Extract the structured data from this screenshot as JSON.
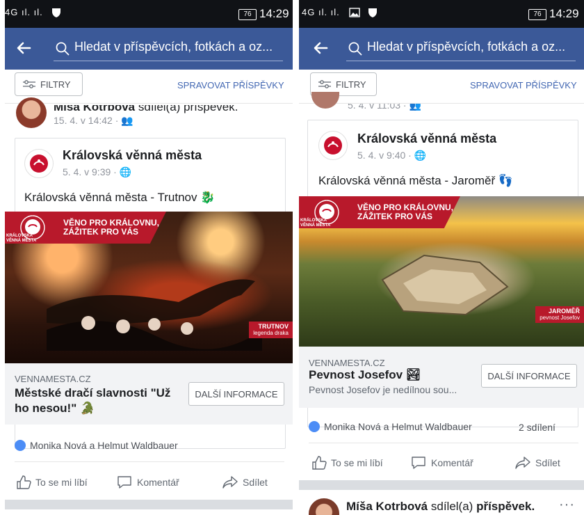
{
  "left": {
    "status": {
      "network": "4G",
      "battery": "76",
      "time": "14:29"
    },
    "search": {
      "placeholder": "Hledat v příspěvcích, fotkách a oz..."
    },
    "filter_label": "FILTRY",
    "manage_label": "SPRAVOVAT PŘÍSPĚVKY",
    "sharer": {
      "name": "Míša Kotrbová",
      "action": "sdílel(a) příspěvek.",
      "meta": "15. 4. v 14:42 · "
    },
    "post": {
      "page_name": "Královská věnná města",
      "meta": "5. 4. v 9:39 · ",
      "text": "Královská věnná města - Trutnov",
      "banner_line1": "VĚNO PRO KRÁLOVNU,",
      "banner_line2": "ZÁŽITEK PRO VÁS",
      "brand_line1": "KRÁLOVSKÁ",
      "brand_line2": "VĚNNÁ MĚSTA",
      "corner_title": "TRUTNOV",
      "corner_sub": "legenda draka",
      "link_domain": "VENNAMESTA.CZ",
      "link_title": "Městské dračí slavnosti \"Už ho nesou!\"",
      "cta": "DALŠÍ INFORMACE"
    },
    "reactions": "Monika Nová a Helmut Waldbauer",
    "actions": {
      "like": "To se mi líbí",
      "comment": "Komentář",
      "share": "Sdílet"
    }
  },
  "right": {
    "status": {
      "network": "4G",
      "battery": "76",
      "time": "14:29"
    },
    "search": {
      "placeholder": "Hledat v příspěvcích, fotkách a oz..."
    },
    "filter_label": "FILTRY",
    "manage_label": "SPRAVOVAT PŘÍSPĚVKY",
    "sharer_meta": "5. 4. v 11:03 · ",
    "post": {
      "page_name": "Královská věnná města",
      "meta": "5. 4. v 9:40 · ",
      "text": "Královská věnná města - Jaroměř",
      "banner_line1": "VĚNO PRO KRÁLOVNU,",
      "banner_line2": "ZÁŽITEK PRO VÁS",
      "brand_line1": "KRÁLOVSKÁ",
      "brand_line2": "VĚNNÁ MĚSTA",
      "corner_title": "JAROMĚŘ",
      "corner_sub": "pevnost Josefov",
      "link_domain": "VENNAMESTA.CZ",
      "link_title": "Pevnost Josefov",
      "link_desc": "Pevnost Josefov je nedílnou sou...",
      "cta": "DALŠÍ INFORMACE"
    },
    "reactions": "Monika Nová a Helmut Waldbauer",
    "shares": "2 sdílení",
    "actions": {
      "like": "To se mi líbí",
      "comment": "Komentář",
      "share": "Sdílet"
    },
    "next_sharer": {
      "name": "Míša Kotrbová",
      "action_prefix": "sdílel(a)",
      "action_word": "příspěvek."
    }
  },
  "colors": {
    "nav_blue": "#3b5998",
    "brand_red": "#b8192b",
    "link_blue": "#4267b2"
  }
}
